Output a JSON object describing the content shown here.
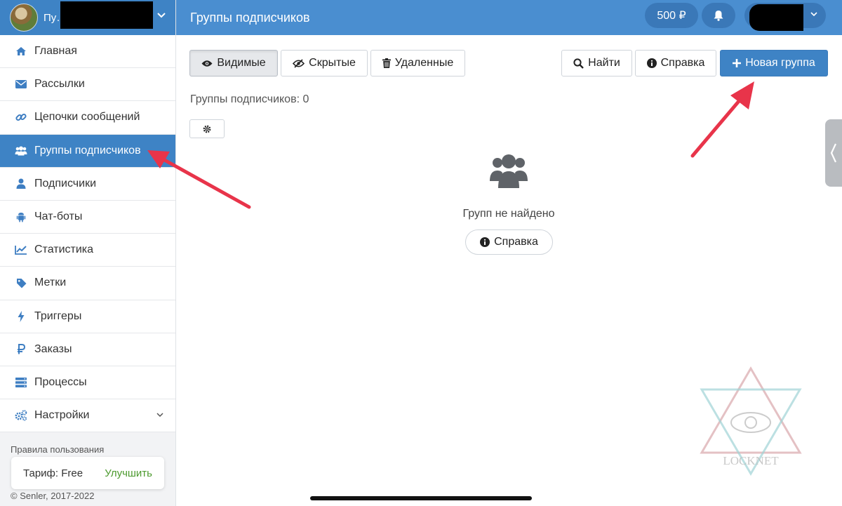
{
  "sidebar": {
    "user_name": "Пу… ме…",
    "items": [
      {
        "label": "Главная",
        "icon": "home-icon"
      },
      {
        "label": "Рассылки",
        "icon": "envelope-icon"
      },
      {
        "label": "Цепочки сообщений",
        "icon": "link-icon"
      },
      {
        "label": "Группы подписчиков",
        "icon": "users-icon",
        "active": true
      },
      {
        "label": "Подписчики",
        "icon": "user-icon"
      },
      {
        "label": "Чат-боты",
        "icon": "android-icon"
      },
      {
        "label": "Статистика",
        "icon": "line-chart-icon"
      },
      {
        "label": "Метки",
        "icon": "tag-icon"
      },
      {
        "label": "Триггеры",
        "icon": "bolt-icon"
      },
      {
        "label": "Заказы",
        "icon": "ruble-icon"
      },
      {
        "label": "Процессы",
        "icon": "server-icon"
      },
      {
        "label": "Настройки",
        "icon": "cogs-icon"
      }
    ],
    "terms_link": "Правила пользования",
    "tariff_label": "Тариф: Free",
    "upgrade_label": "Улучшить",
    "copyright": "© Senler, 2017-2022"
  },
  "topbar": {
    "title": "Группы подписчиков",
    "balance": "500 ₽"
  },
  "toolbar": {
    "visible_label": "Видимые",
    "hidden_label": "Скрытые",
    "deleted_label": "Удаленные",
    "find_label": "Найти",
    "help_label": "Справка",
    "new_group_label": "Новая группа"
  },
  "main": {
    "count_text": "Группы подписчиков: 0",
    "empty_text": "Групп не найдено",
    "empty_help_label": "Справка"
  },
  "watermark": {
    "text": "LOCKNET"
  },
  "colors": {
    "accent": "#3e83c5",
    "topbar": "#4a8ed0",
    "upgrade": "#4c9a2e",
    "arrow": "#e8344a"
  }
}
